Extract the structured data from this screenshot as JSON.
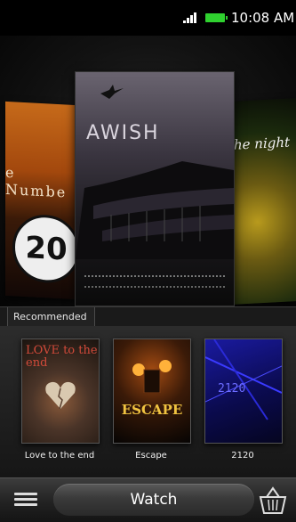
{
  "status_bar": {
    "time": "10:08 AM"
  },
  "carousel": {
    "left_poster_title": "e Numbe",
    "left_poster_number": "20",
    "center_poster_title": "AWISH",
    "right_poster_title": "he night"
  },
  "recommended": {
    "tab_label": "Recommended",
    "items": [
      {
        "title": "Love to the end",
        "poster_text": "LOVE to the end"
      },
      {
        "title": "Escape",
        "poster_text": "ESCAPE"
      },
      {
        "title": "2120",
        "poster_text": "2120"
      }
    ]
  },
  "bottom_bar": {
    "label": "Watch"
  },
  "colors": {
    "battery": "#2fd12f",
    "background": "#000000"
  }
}
